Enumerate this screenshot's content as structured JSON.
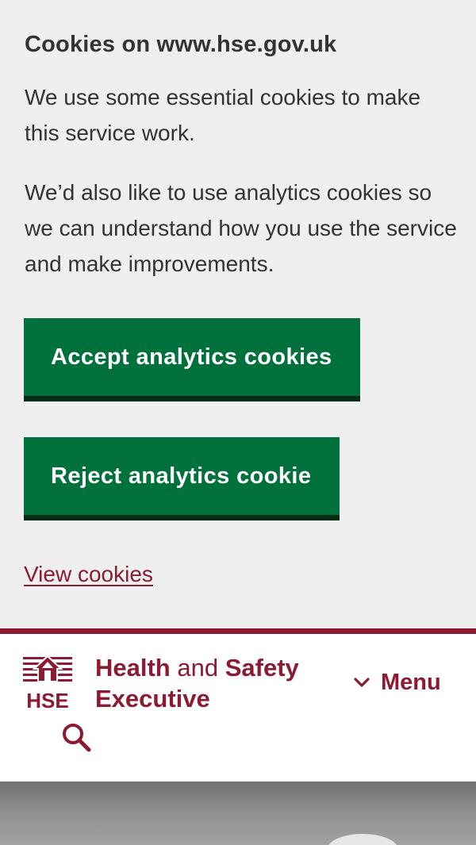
{
  "cookie_banner": {
    "title": "Cookies on www.hse.gov.uk",
    "paragraph_1": "We use some essential cookies to make this service work.",
    "paragraph_2": "We’d also like to use analytics cookies so we can understand how you use the service and make improvements.",
    "accept_label": "Accept analytics cookies",
    "reject_label": "Reject analytics cookie",
    "view_link": "View cookies"
  },
  "header": {
    "logo_mark_text": "HSE",
    "org_name_word_1": "Health",
    "org_name_word_2": "and",
    "org_name_word_3": "Safety",
    "org_name_line_2": "Executive",
    "menu_label": "Menu",
    "menu_icon": "chevron-down-icon",
    "search_icon": "search-icon"
  },
  "colors": {
    "banner_background": "#efefef",
    "button_green": "#00703c",
    "button_shadow": "#002d18",
    "brand_maroon": "#8b1a32",
    "text_dark": "#333333"
  }
}
